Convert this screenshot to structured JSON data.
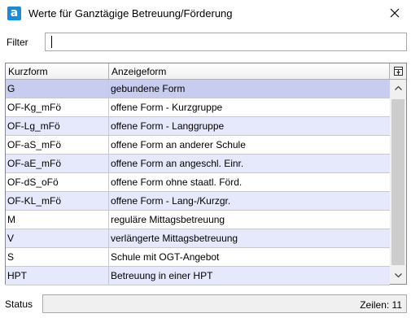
{
  "window": {
    "title": "Werte für Ganztägige Betreuung/Förderung",
    "app_icon_letter": "a",
    "app_icon_color": "#1c8ad6"
  },
  "filter": {
    "label": "Filter",
    "value": "",
    "placeholder": ""
  },
  "table": {
    "columns": [
      "Kurzform",
      "Anzeigeform"
    ],
    "rows": [
      {
        "kurzform": "G",
        "anzeigeform": "gebundene Form"
      },
      {
        "kurzform": "OF-Kg_mFö",
        "anzeigeform": "offene Form - Kurzgruppe"
      },
      {
        "kurzform": "OF-Lg_mFö",
        "anzeigeform": "offene Form - Langgruppe"
      },
      {
        "kurzform": "OF-aS_mFö",
        "anzeigeform": "offene Form an anderer Schule"
      },
      {
        "kurzform": "OF-aE_mFö",
        "anzeigeform": "offene Form an angeschl. Einr."
      },
      {
        "kurzform": "OF-dS_oFö",
        "anzeigeform": "offene Form ohne staatl. Förd."
      },
      {
        "kurzform": "OF-KL_mFö",
        "anzeigeform": "offene Form - Lang-/Kurzgr."
      },
      {
        "kurzform": "M",
        "anzeigeform": "reguläre Mittagsbetreuung"
      },
      {
        "kurzform": "V",
        "anzeigeform": "verlängerte Mittagsbetreuung"
      },
      {
        "kurzform": "S",
        "anzeigeform": "Schule mit OGT-Angebot"
      },
      {
        "kurzform": "HPT",
        "anzeigeform": "Betreuung in einer HPT"
      }
    ],
    "selected_row": 0,
    "alt_color": "#e6e8fb",
    "selected_color": "#c8cdf0"
  },
  "status": {
    "label": "Status",
    "rows_count": "Zeilen: 11"
  }
}
